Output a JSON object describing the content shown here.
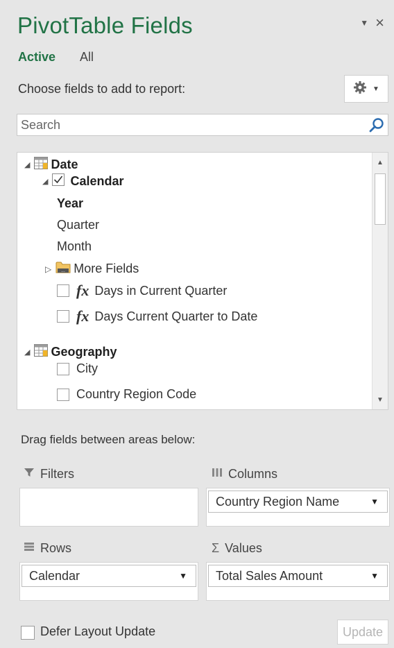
{
  "pane": {
    "title": "PivotTable Fields",
    "tabs": [
      {
        "label": "Active"
      },
      {
        "label": "All"
      }
    ],
    "choose_label": "Choose fields to add to report:",
    "search": {
      "placeholder": "Search"
    }
  },
  "fields": {
    "date_table": "Date",
    "calendar": "Calendar",
    "year": "Year",
    "quarter": "Quarter",
    "month": "Month",
    "more_fields": "More Fields",
    "days_in_current_quarter": "Days in Current Quarter",
    "days_current_quarter_to_date": "Days Current Quarter to Date",
    "geography_table": "Geography",
    "city": "City",
    "country_region_code": "Country Region Code",
    "fx_symbol": "fx"
  },
  "areas": {
    "drag_label": "Drag fields between areas below:",
    "filters": {
      "label": "Filters"
    },
    "columns": {
      "label": "Columns",
      "items": [
        "Country Region Name"
      ]
    },
    "rows": {
      "label": "Rows",
      "items": [
        "Calendar"
      ]
    },
    "values": {
      "label": "Values",
      "symbol": "Σ",
      "items": [
        "Total Sales Amount"
      ]
    }
  },
  "footer": {
    "defer_label": "Defer Layout Update",
    "update_label": "Update"
  },
  "colors": {
    "accent": "#217346",
    "panel_bg": "#e6e6e6"
  }
}
